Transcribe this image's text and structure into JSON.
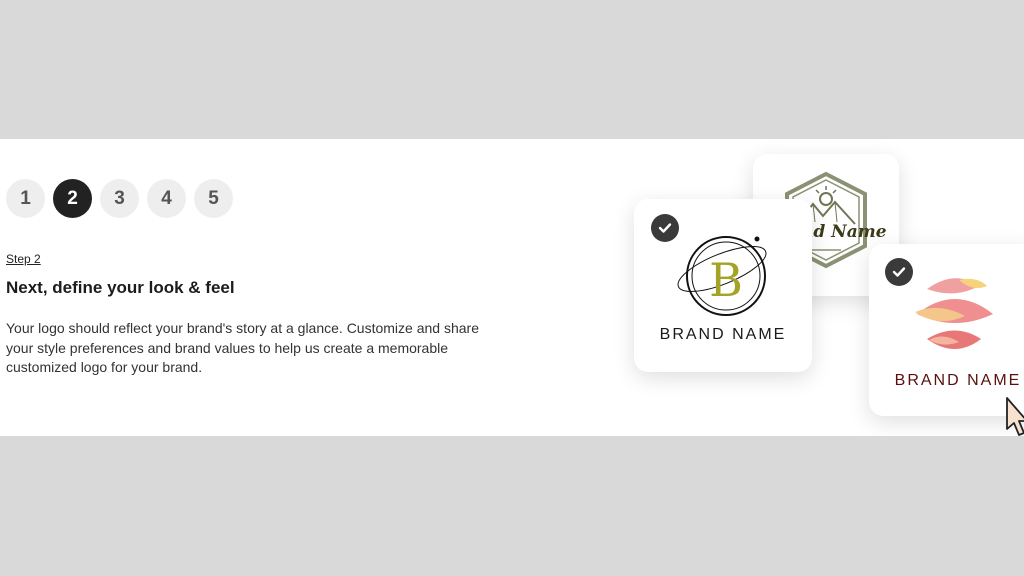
{
  "steps": [
    "1",
    "2",
    "3",
    "4",
    "5"
  ],
  "active_step": "2",
  "content": {
    "step_label": "Step 2",
    "heading": "Next, define your look & feel",
    "description": "Your logo should reflect your brand's story at a glance. Customize and share your style preferences and brand values to help us create a memorable customized logo for your brand."
  },
  "cards": {
    "back": {
      "text": "nd Name"
    },
    "main": {
      "monogram": "B",
      "brand": "BRAND NAME"
    },
    "right": {
      "brand": "BRAND NAME"
    }
  },
  "icons": {
    "check": "check-icon",
    "cursor": "cursor-pointer-icon"
  },
  "colors": {
    "band_bg": "#ffffff",
    "outer_bg": "#d9d9d9",
    "active_step": "#222222",
    "monogram": "#a3a325",
    "brand_right": "#5a1010"
  }
}
